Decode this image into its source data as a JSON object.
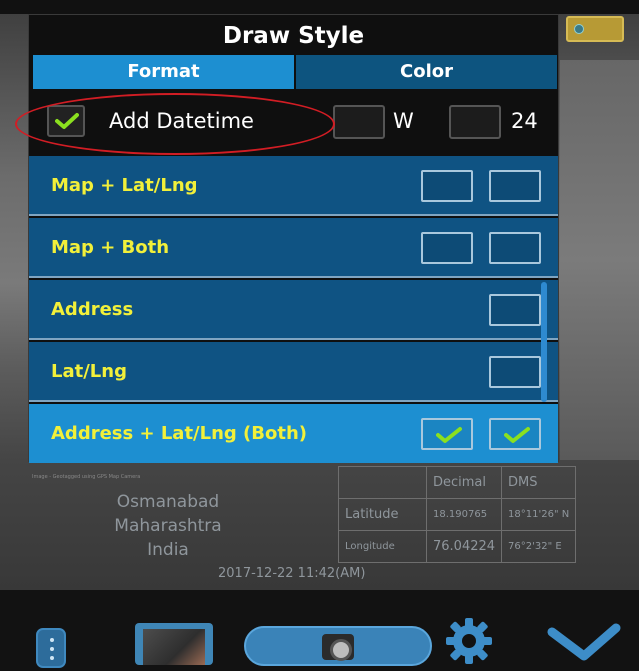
{
  "dialog": {
    "title": "Draw Style",
    "tabs": [
      {
        "label": "Format",
        "active": true
      },
      {
        "label": "Color",
        "active": false
      }
    ],
    "options": {
      "add_datetime": {
        "label": "Add Datetime",
        "checked": true
      },
      "w": {
        "label": "W",
        "checked": false
      },
      "h24": {
        "label": "24",
        "checked": false
      }
    },
    "formats": [
      {
        "label": "Map + Lat/Lng",
        "checks": [
          false,
          false
        ]
      },
      {
        "label": "Map + Both",
        "checks": [
          false,
          false
        ]
      },
      {
        "label": "Address",
        "checks": [
          false
        ]
      },
      {
        "label": "Lat/Lng",
        "checks": [
          false
        ]
      },
      {
        "label": "Address + Lat/Lng (Both)",
        "checks": [
          true,
          true
        ],
        "selected": true
      }
    ]
  },
  "overlay": {
    "attribution": "Image - Geotagged using GPS Map Camera",
    "address": [
      "Osmanabad",
      "Maharashtra",
      "India"
    ],
    "table": {
      "headers": [
        "",
        "Decimal",
        "DMS"
      ],
      "rows": [
        {
          "label": "Latitude",
          "decimal": "18.190765",
          "dms": "18°11'26\" N"
        },
        {
          "label": "Longitude",
          "decimal": "76.04224",
          "dms": "76°2'32\" E"
        }
      ]
    },
    "datetime": "2017-12-22  11:42(AM)"
  },
  "colors": {
    "accent": "#1d8fd1",
    "list_bg": "#0f5383",
    "label_yellow": "#f2f03a",
    "highlight_red": "#d21d24"
  },
  "icons": {
    "toolbar": [
      "menu-icon",
      "gallery-icon",
      "shutter-icon",
      "settings-icon",
      "confirm-check-icon"
    ]
  }
}
